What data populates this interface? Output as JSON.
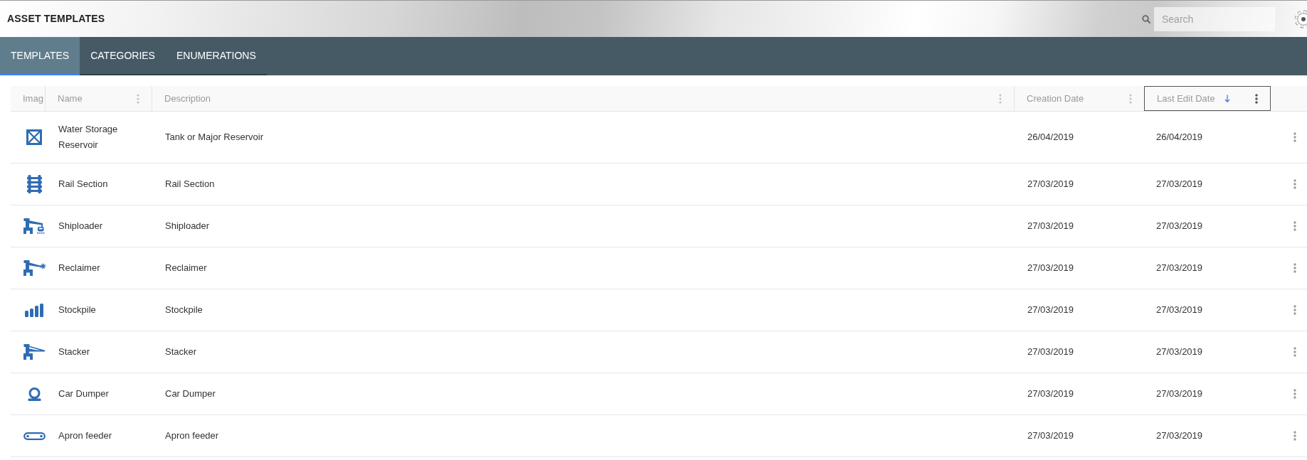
{
  "header": {
    "title": "ASSET TEMPLATES",
    "search": {
      "placeholder": "Search"
    }
  },
  "tabs": [
    {
      "label": "TEMPLATES",
      "selected": true
    },
    {
      "label": "CATEGORIES",
      "selected": false
    },
    {
      "label": "ENUMERATIONS",
      "selected": false
    }
  ],
  "table": {
    "columns": [
      {
        "label": "Imag",
        "menu": false,
        "sorted": false,
        "focused": false
      },
      {
        "label": "Name",
        "menu": true,
        "sorted": false,
        "focused": false
      },
      {
        "label": "Description",
        "menu": true,
        "sorted": false,
        "focused": false
      },
      {
        "label": "Creation Date",
        "menu": true,
        "sorted": false,
        "focused": false
      },
      {
        "label": "Last Edit Date",
        "menu": true,
        "sorted": true,
        "focused": true
      }
    ],
    "rows": [
      {
        "name": "Water Storage Reservoir",
        "description": "Tank or Major Reservoir",
        "creation_date": "26/04/2019",
        "last_edit_date": "26/04/2019"
      },
      {
        "name": "Rail Section",
        "description": "Rail Section",
        "creation_date": "27/03/2019",
        "last_edit_date": "27/03/2019"
      },
      {
        "name": "Shiploader",
        "description": "Shiploader",
        "creation_date": "27/03/2019",
        "last_edit_date": "27/03/2019"
      },
      {
        "name": "Reclaimer",
        "description": "Reclaimer",
        "creation_date": "27/03/2019",
        "last_edit_date": "27/03/2019"
      },
      {
        "name": "Stockpile",
        "description": "Stockpile",
        "creation_date": "27/03/2019",
        "last_edit_date": "27/03/2019"
      },
      {
        "name": "Stacker",
        "description": "Stacker",
        "creation_date": "27/03/2019",
        "last_edit_date": "27/03/2019"
      },
      {
        "name": "Car Dumper",
        "description": "Car Dumper",
        "creation_date": "27/03/2019",
        "last_edit_date": "27/03/2019"
      },
      {
        "name": "Apron feeder",
        "description": "Apron feeder",
        "creation_date": "27/03/2019",
        "last_edit_date": "27/03/2019"
      }
    ]
  }
}
